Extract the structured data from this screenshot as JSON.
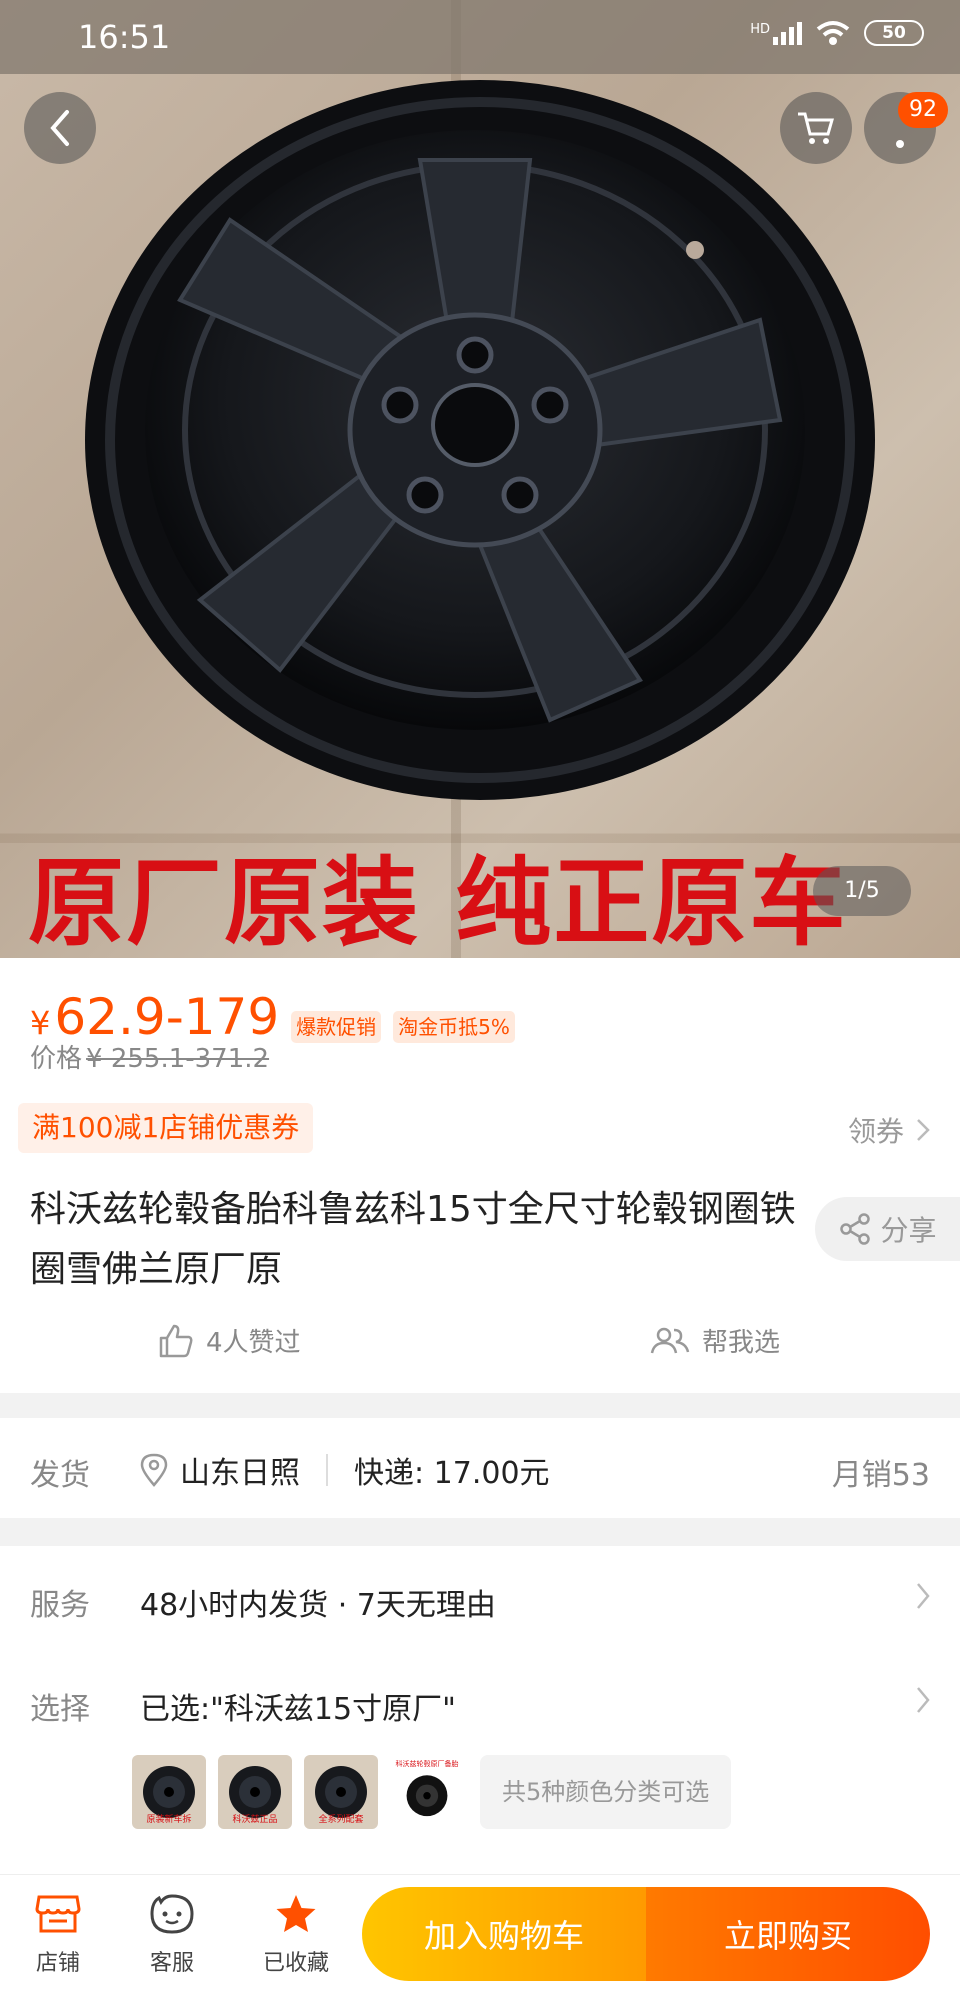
{
  "status_bar": {
    "time": "16:51",
    "network": "HD",
    "battery": "50"
  },
  "hero": {
    "banner_text": "原厂原装  纯正原车",
    "pager": "1/5",
    "cart_badge": "92"
  },
  "price": {
    "currency": "¥",
    "range": "62.9-179",
    "tags": [
      "爆款促销",
      "淘金币抵5%"
    ],
    "original_label": "价格",
    "original_range": "¥ 255.1-371.2"
  },
  "coupon": {
    "text": "满100减1店铺优惠券",
    "action": "领券"
  },
  "product": {
    "title": "科沃兹轮毂备胎科鲁兹科15寸全尺寸轮毂钢圈铁圈雪佛兰原厂原",
    "share": "分享",
    "likes": "4人赞过",
    "help_choose": "帮我选"
  },
  "shipping": {
    "label": "发货",
    "location": "山东日照",
    "express": "快递: 17.00元",
    "monthly_sales": "月销53"
  },
  "service": {
    "label": "服务",
    "value": "48小时内发货  ·  7天无理由"
  },
  "selection": {
    "label": "选择",
    "value": "已选:\"科沃兹15寸原厂\"",
    "thumb_captions": [
      "原装新车拆",
      "科沃兹正品",
      "全系列配套",
      "科沃兹轮毂原厂备胎"
    ],
    "more": "共5种颜色分类可选"
  },
  "bottom_bar": {
    "shop": "店铺",
    "service": "客服",
    "favorite": "已收藏",
    "add_to_cart": "加入购物车",
    "buy_now": "立即购买"
  },
  "colors": {
    "accent": "#ff5000",
    "banner_red": "#d80f14",
    "cart_gradient_start": "#ffc500",
    "buy_gradient_end": "#ff4e00"
  }
}
